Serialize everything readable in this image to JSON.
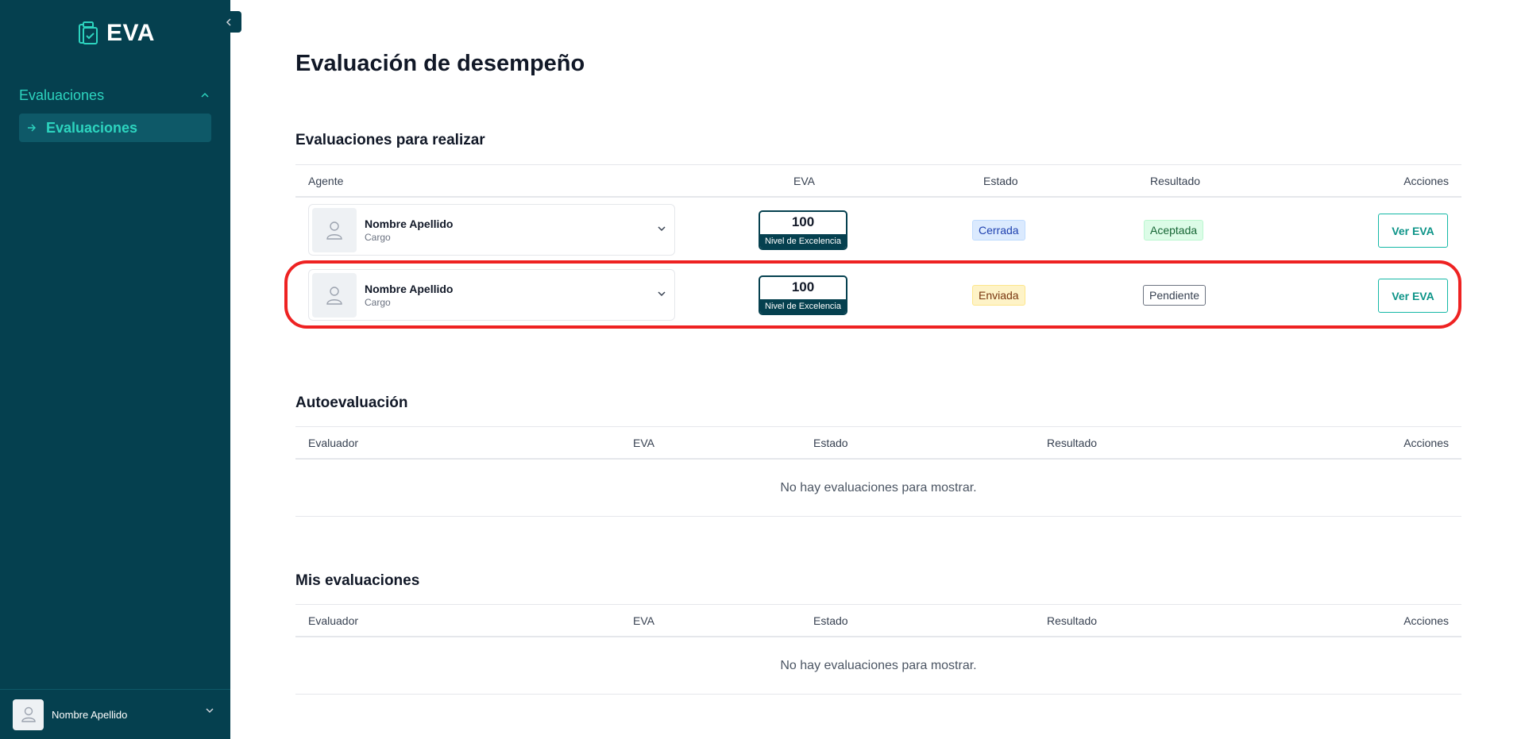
{
  "app": {
    "name": "EVA"
  },
  "sidebar": {
    "section_label": "Evaluaciones",
    "items": [
      {
        "label": "Evaluaciones",
        "active": true
      }
    ],
    "user": {
      "name": "Nombre Apellido"
    }
  },
  "page": {
    "title": "Evaluación de desempeño"
  },
  "para_realizar": {
    "title": "Evaluaciones para realizar",
    "columns": {
      "agente": "Agente",
      "eva": "EVA",
      "estado": "Estado",
      "resultado": "Resultado",
      "acciones": "Acciones"
    },
    "rows": [
      {
        "name": "Nombre Apellido",
        "role": "Cargo",
        "eva_value": "100",
        "eva_label": "Nivel de Excelencia",
        "estado": "Cerrada",
        "resultado": "Aceptada",
        "action": "Ver EVA"
      },
      {
        "name": "Nombre Apellido",
        "role": "Cargo",
        "eva_value": "100",
        "eva_label": "Nivel de Excelencia",
        "estado": "Enviada",
        "resultado": "Pendiente",
        "action": "Ver EVA"
      }
    ]
  },
  "autoevaluacion": {
    "title": "Autoevaluación",
    "columns": {
      "evaluador": "Evaluador",
      "eva": "EVA",
      "estado": "Estado",
      "resultado": "Resultado",
      "acciones": "Acciones"
    },
    "empty": "No hay evaluaciones para mostrar."
  },
  "mis_evaluaciones": {
    "title": "Mis evaluaciones",
    "columns": {
      "evaluador": "Evaluador",
      "eva": "EVA",
      "estado": "Estado",
      "resultado": "Resultado",
      "acciones": "Acciones"
    },
    "empty": "No hay evaluaciones para mostrar."
  },
  "colors": {
    "sidebar": "#05404f",
    "accent": "#2dd4bf",
    "highlight": "#ee2222"
  }
}
